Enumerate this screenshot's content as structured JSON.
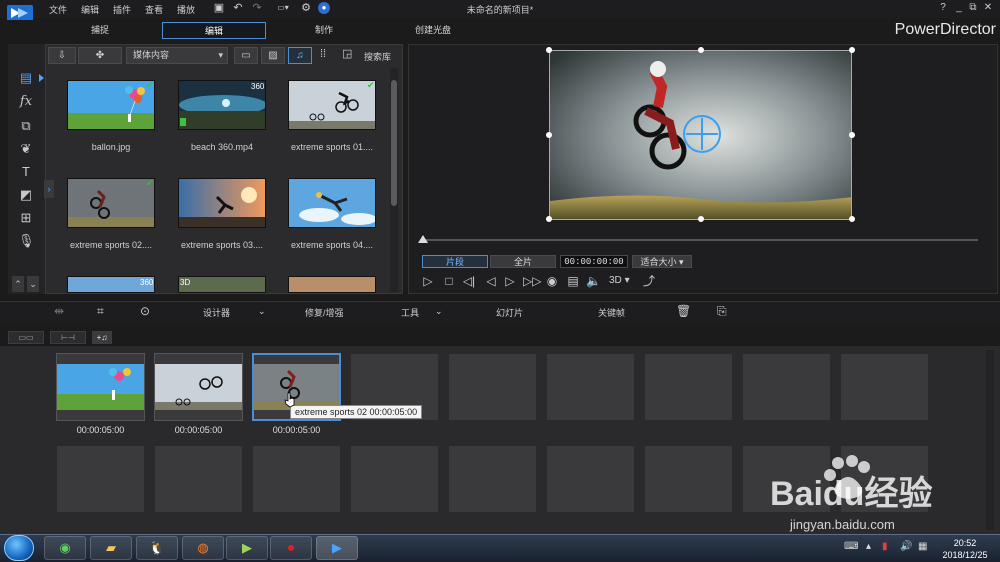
{
  "menu": {
    "items": [
      "文件",
      "编辑",
      "插件",
      "查看",
      "播放"
    ],
    "window_title": "未命名的新项目*"
  },
  "window_controls": [
    "?",
    "_",
    "⧉",
    "✕"
  ],
  "mode_tabs": [
    {
      "label": "捕捉"
    },
    {
      "label": "编辑"
    },
    {
      "label": "制作"
    },
    {
      "label": "创建光盘"
    }
  ],
  "brand": "PowerDirector",
  "library": {
    "media_select": "媒体内容",
    "search_label": "搜索库",
    "items": [
      {
        "label": "ballon.jpg",
        "badge": ""
      },
      {
        "label": "beach 360.mp4",
        "badge": "360"
      },
      {
        "label": "extreme sports 01....",
        "badge": ""
      },
      {
        "label": "extreme sports 02....",
        "badge": ""
      },
      {
        "label": "extreme sports 03....",
        "badge": ""
      },
      {
        "label": "extreme sports 04....",
        "badge": ""
      }
    ],
    "row3_badges": [
      "360",
      "3D"
    ]
  },
  "preview": {
    "clip_label": "片段",
    "full_label": "全片",
    "timecode": "00:00:00:00",
    "fit_label": "适合大小",
    "mode_3d": "3D"
  },
  "edit_toolbar": {
    "designer": "设计器",
    "repair": "修复/增强",
    "tools": "工具",
    "slideshow": "幻灯片",
    "keyframe": "关键帧"
  },
  "storyboard": {
    "clips": [
      {
        "time": "00:00:05:00"
      },
      {
        "time": "00:00:05:00"
      },
      {
        "time": "00:00:05:00"
      }
    ],
    "tooltip": "extreme sports 02  00:00:05:00"
  },
  "taskbar": {
    "time": "20:52",
    "date": "2018/12/25"
  },
  "watermark": {
    "brand": "Baidu经验",
    "url": "jingyan.baidu.com"
  },
  "colors": {
    "accent": "#4a8fd6",
    "background": "#1b1b1c",
    "panel": "#2b2b2d",
    "slot": "#3a3a3c"
  }
}
